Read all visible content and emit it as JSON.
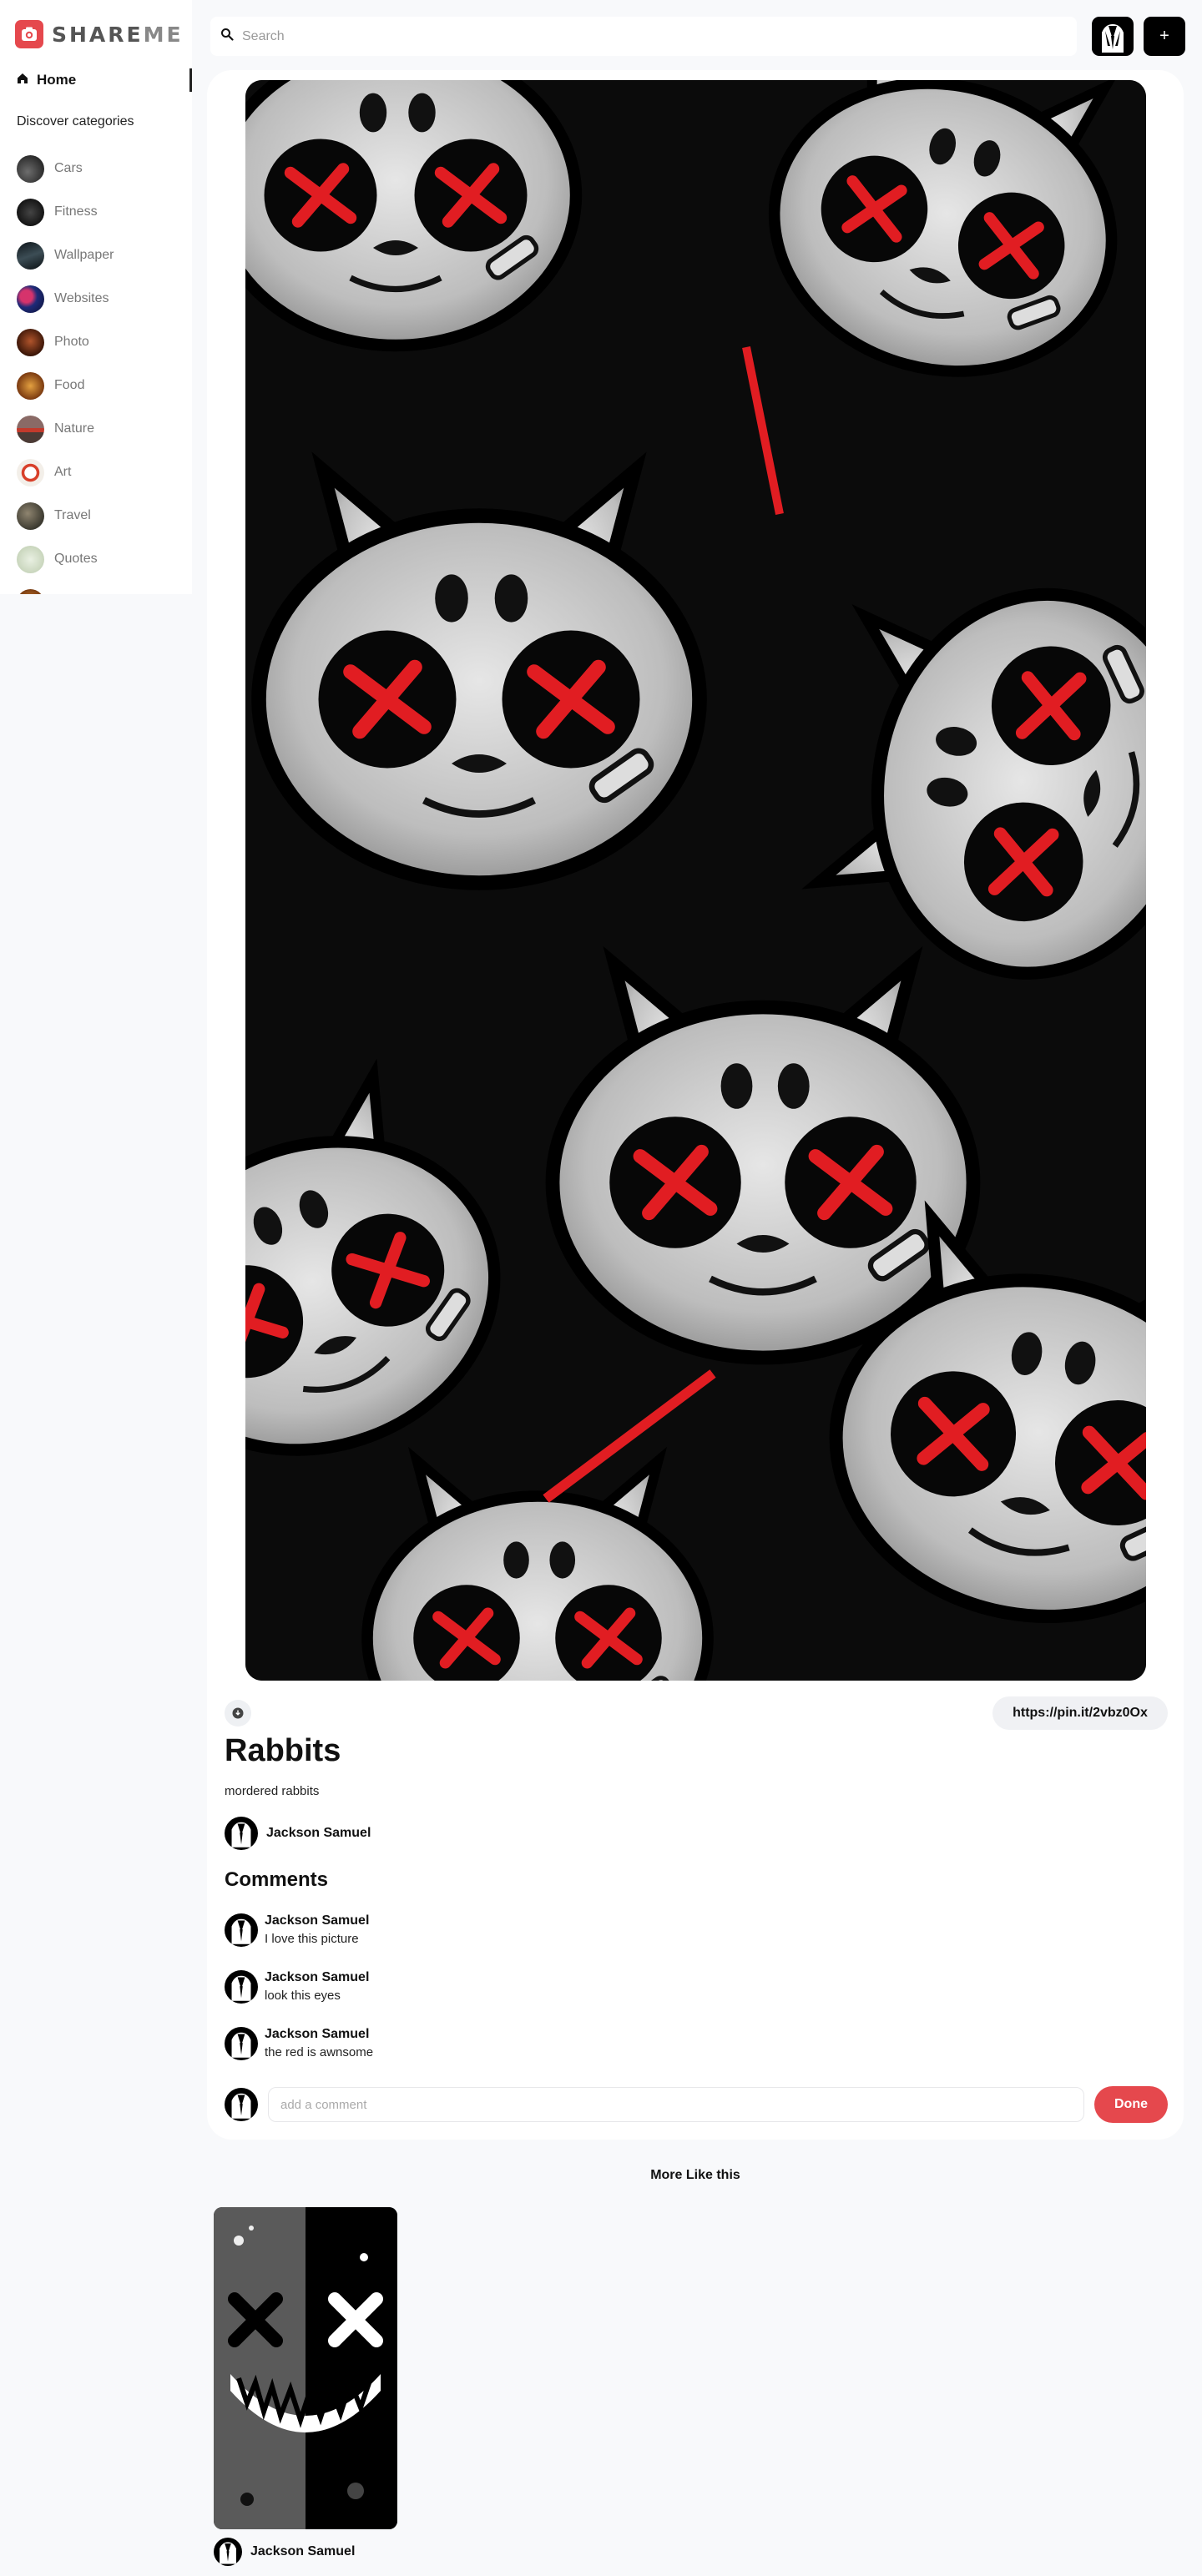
{
  "app": {
    "logo_text_a": "SHARE",
    "logo_text_b": "ME"
  },
  "sidebar": {
    "home_label": "Home",
    "categories_title": "Discover categories",
    "categories": [
      {
        "label": "Cars",
        "icon": "cars-thumb"
      },
      {
        "label": "Fitness",
        "icon": "fitness-thumb"
      },
      {
        "label": "Wallpaper",
        "icon": "wallpaper-thumb"
      },
      {
        "label": "Websites",
        "icon": "websites-thumb"
      },
      {
        "label": "Photo",
        "icon": "photo-thumb"
      },
      {
        "label": "Food",
        "icon": "food-thumb"
      },
      {
        "label": "Nature",
        "icon": "nature-thumb"
      },
      {
        "label": "Art",
        "icon": "art-thumb"
      },
      {
        "label": "Travel",
        "icon": "travel-thumb"
      },
      {
        "label": "Quotes",
        "icon": "quotes-thumb"
      }
    ]
  },
  "search": {
    "placeholder": "Search",
    "value": ""
  },
  "header": {
    "add_label": "+"
  },
  "pin": {
    "link": "https://pin.it/2vbz0Ox",
    "title": "Rabbits",
    "description": "mordered rabbits",
    "posted_by": "Jackson Samuel"
  },
  "comments": {
    "title": "Comments",
    "items": [
      {
        "author": "Jackson Samuel",
        "text": "I love this picture"
      },
      {
        "author": "Jackson Samuel",
        "text": "look this eyes"
      },
      {
        "author": "Jackson Samuel",
        "text": "the red is awnsome"
      }
    ],
    "input_placeholder": "add a comment",
    "done_label": "Done"
  },
  "more": {
    "title": "More Like this",
    "pins": [
      {
        "author": "Jackson Samuel"
      }
    ]
  },
  "colors": {
    "accent": "#e5484d",
    "background": "#f8f9fb",
    "card": "#ffffff",
    "dark": "#000000"
  }
}
